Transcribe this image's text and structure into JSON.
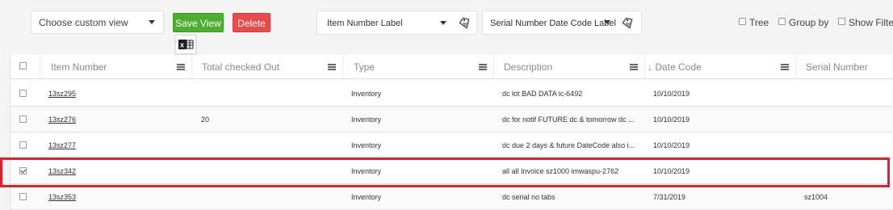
{
  "toolbar": {
    "custom_view_placeholder": "Choose custom view",
    "save_view_label": "Save View",
    "delete_label": "Delete",
    "item_number_label": "Item Number Label",
    "serial_date_code_label": "Serial Number Date Code Label",
    "options": {
      "tree": "Tree",
      "group_by": "Group by",
      "show_filter": "Show Filter"
    },
    "icons": {
      "excel": "excel-export-icon",
      "tag": "print-tag-icon",
      "caret": "chevron-down-icon",
      "column_menu": "menu-icon"
    },
    "colors": {
      "save": "#4caf2e",
      "delete": "#e84b4b",
      "highlight": "#e3202a"
    }
  },
  "columns": {
    "item_number": "Item Number",
    "total_checked_out": "Total checked Out",
    "type": "Type",
    "description": "Description",
    "date_code": "↓ Date Code",
    "serial_number": "Serial Number"
  },
  "rows": [
    {
      "checked": false,
      "item_number": "13sz295",
      "total": "",
      "type": "Inventory",
      "description": "dc lot BAD DATA ic-6492",
      "date_code": "10/10/2019",
      "serial": ""
    },
    {
      "checked": false,
      "item_number": "13sz276",
      "total": "20",
      "type": "Inventory",
      "description": "dc for notif FUTURE dc & tomorrow dc ...",
      "date_code": "10/10/2019",
      "serial": ""
    },
    {
      "checked": false,
      "item_number": "13sz277",
      "total": "",
      "type": "Inventory",
      "description": "dc due 2 days & future DateCode also i...",
      "date_code": "10/10/2019",
      "serial": ""
    },
    {
      "checked": true,
      "item_number": "13sz342",
      "total": "",
      "type": "Inventory",
      "description": "all all Invoice sz1000 imwaspu-2762",
      "date_code": "10/10/2019",
      "serial": ""
    },
    {
      "checked": false,
      "item_number": "13sz353",
      "total": "",
      "type": "Inventory",
      "description": "dc serial no tabs",
      "date_code": "7/31/2019",
      "serial": "sz1004"
    }
  ]
}
